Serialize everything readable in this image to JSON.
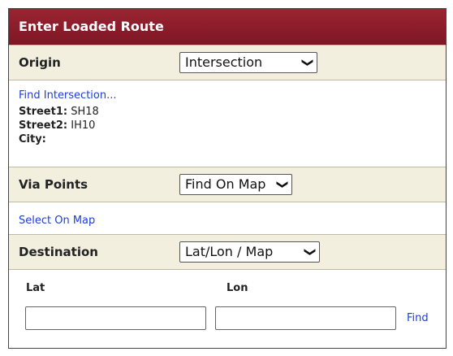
{
  "panel": {
    "title": "Enter Loaded Route"
  },
  "origin": {
    "label": "Origin",
    "select_value": "Intersection",
    "find_link": "Find Intersection...",
    "street1_label": "Street1:",
    "street1_value": "SH18",
    "street2_label": "Street2:",
    "street2_value": "IH10",
    "city_label": "City:",
    "city_value": ""
  },
  "via_points": {
    "label": "Via Points",
    "select_value": "Find On Map",
    "select_link": "Select On Map"
  },
  "destination": {
    "label": "Destination",
    "select_value": "Lat/Lon / Map",
    "lat_label": "Lat",
    "lon_label": "Lon",
    "lat_value": "",
    "lon_value": "",
    "find_link": "Find"
  },
  "icons": {
    "dropdown": "chevron-down-icon"
  }
}
